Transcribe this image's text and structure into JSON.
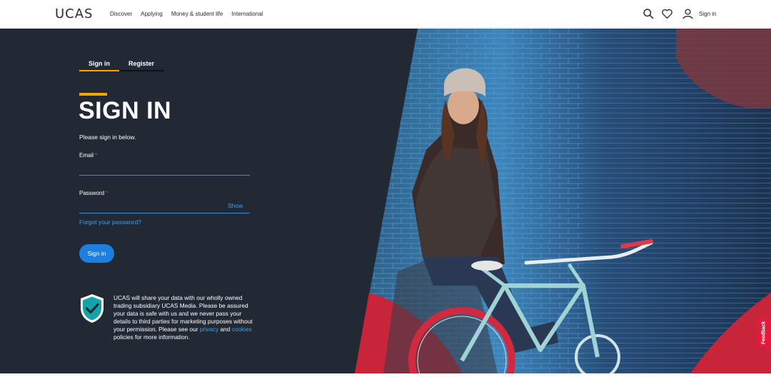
{
  "header": {
    "logo": "UCAS",
    "nav": [
      "Discover",
      "Applying",
      "Money & student life",
      "International"
    ],
    "icons": [
      "search-icon",
      "heart-icon",
      "user-icon"
    ],
    "signin_label": "Sign in"
  },
  "form": {
    "tabs": [
      {
        "label": "Sign in",
        "active": true
      },
      {
        "label": "Register",
        "active": false
      }
    ],
    "title": "SIGN IN",
    "subtitle": "Please sign in below.",
    "email_label": "Email",
    "password_label": "Password",
    "required_mark": "*",
    "email_value": "",
    "password_value": "",
    "show_label": "Show",
    "forgot_label": "Forgot your password?",
    "submit_label": "Sign in"
  },
  "notice": {
    "icon": "shield-check-icon",
    "text_before": "UCAS will share your data with our wholly owned trading subsidiary UCAS Media. Please be assured your data is safe with us and we never pass your details to third parties for marketing purposes without your permission. Please see our",
    "privacy_link": "privacy",
    "and_text": "and",
    "cookies_link": "cookies",
    "text_after": "policies for more information."
  },
  "feedback_label": "Feedback",
  "colors": {
    "accent": "#f7a600",
    "link": "#3ea0f5",
    "button": "#1d80e0",
    "hero_bg": "#212935",
    "feedback": "#e21b3c"
  }
}
